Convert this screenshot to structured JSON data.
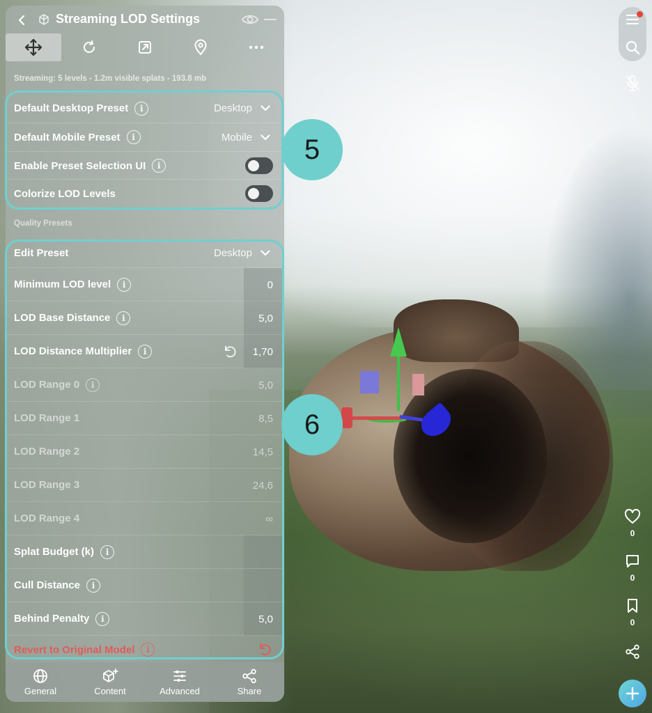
{
  "panel": {
    "title": "Streaming LOD Settings",
    "status": "Streaming: 5 levels - 1.2m visible splats - 193.8 mb"
  },
  "toolbar": {
    "tools": [
      "move-icon",
      "rotate-icon",
      "external-link-icon",
      "location-pin-icon",
      "more-icon"
    ],
    "active_tool": "move-icon"
  },
  "presets": {
    "desktop_label": "Default Desktop Preset",
    "desktop_value": "Desktop",
    "mobile_label": "Default Mobile Preset",
    "mobile_value": "Mobile",
    "selection_ui_label": "Enable Preset Selection UI",
    "selection_ui_on": false,
    "colorize_label": "Colorize LOD Levels",
    "colorize_on": false
  },
  "quality": {
    "section_label": "Quality Presets",
    "edit_preset_label": "Edit Preset",
    "edit_preset_value": "Desktop",
    "min_lod_label": "Minimum LOD level",
    "min_lod_value": "0",
    "base_distance_label": "LOD Base Distance",
    "base_distance_value": "5,0",
    "multiplier_label": "LOD Distance Multiplier",
    "multiplier_value": "1,70",
    "ranges": [
      {
        "label": "LOD Range 0",
        "value": "5,0"
      },
      {
        "label": "LOD Range 1",
        "value": "8,5"
      },
      {
        "label": "LOD Range 2",
        "value": "14,5"
      },
      {
        "label": "LOD Range 3",
        "value": "24,6"
      },
      {
        "label": "LOD Range 4",
        "value": "∞"
      }
    ],
    "splat_budget_label": "Splat Budget (k)",
    "cull_distance_label": "Cull Distance",
    "behind_penalty_label": "Behind Penalty",
    "behind_penalty_value": "5,0",
    "revert_label": "Revert to Original Model"
  },
  "annotations": {
    "badge_5": "5",
    "badge_6": "6",
    "highlight_color": "#6fd0cf"
  },
  "bottom_tabs": [
    {
      "label": "General",
      "icon": "globe-icon"
    },
    {
      "label": "Content",
      "icon": "cube-plus-icon"
    },
    {
      "label": "Advanced",
      "icon": "sliders-icon"
    },
    {
      "label": "Share",
      "icon": "share-icon"
    }
  ],
  "rail": {
    "likes": "0",
    "comments": "0",
    "bookmarks": "0"
  }
}
